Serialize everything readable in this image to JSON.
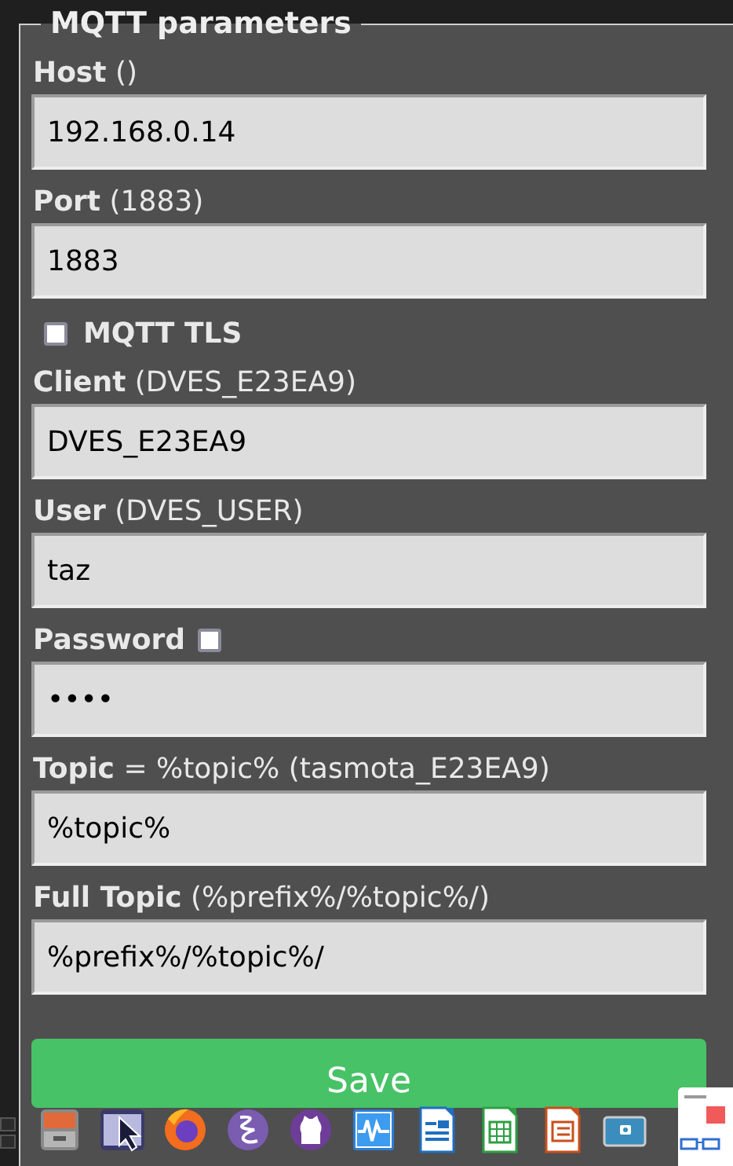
{
  "fieldset": {
    "legend": "MQTT parameters",
    "fields": [
      {
        "kind": "input",
        "label": "**Host** ()",
        "value": "192.168.0.14"
      },
      {
        "kind": "input",
        "label": "**Port** (1883)",
        "value": "1883"
      },
      {
        "kind": "checkbox",
        "label": "MQTT TLS",
        "checked": false
      },
      {
        "kind": "input",
        "label": "**Client** (DVES_E23EA9)",
        "value": "DVES_E23EA9"
      },
      {
        "kind": "input",
        "label": "**User** (DVES_USER)",
        "value": "taz"
      },
      {
        "kind": "password",
        "label": "**Password**",
        "checked": false,
        "value": "••••"
      },
      {
        "kind": "input",
        "label": "**Topic** = %topic% (tasmota_E23EA9)",
        "value": "%topic%"
      },
      {
        "kind": "input",
        "label": "**Full Topic** (%prefix%/%topic%/)",
        "value": "%prefix%/%topic%/"
      }
    ]
  },
  "save_button": {
    "label": "Save"
  }
}
